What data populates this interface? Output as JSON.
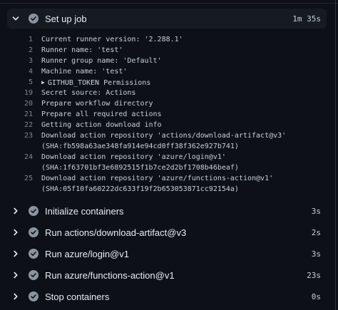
{
  "icons": {
    "chevron_down": "chevron-down-icon",
    "chevron_right": "chevron-right-icon",
    "check_circle": "check-circle-icon",
    "caret_right": "caret-right-icon"
  },
  "colors": {
    "background": "#0d1117",
    "step_expanded_bg": "#161b22",
    "check_circle": "#8b949e",
    "line_number": "#7d8590",
    "text": "#c9d1d9"
  },
  "header_step": {
    "label": "Set up job",
    "duration": "1m 35s"
  },
  "log": {
    "lines": [
      {
        "num": "1",
        "text": "Current runner version: '2.288.1'"
      },
      {
        "num": "2",
        "text": "Runner name: 'test'"
      },
      {
        "num": "3",
        "text": "Runner group name: 'Default'"
      },
      {
        "num": "4",
        "text": "Machine name: 'test'"
      },
      {
        "num": "5",
        "text": "GITHUB_TOKEN Permissions"
      },
      {
        "num": "19",
        "text": "Secret source: Actions"
      },
      {
        "num": "20",
        "text": "Prepare workflow directory"
      },
      {
        "num": "21",
        "text": "Prepare all required actions"
      },
      {
        "num": "22",
        "text": "Getting action download info"
      },
      {
        "num": "23",
        "text": "Download action repository 'actions/download-artifact@v3'"
      },
      {
        "num": "",
        "text": "(SHA:fb598a63ae348fa914e94cd0ff38f362e927b741)"
      },
      {
        "num": "24",
        "text": "Download action repository 'azure/login@v1'"
      },
      {
        "num": "",
        "text": "(SHA:1f63701bf3e6892515f1b7ce2d2bf1708b46beaf)"
      },
      {
        "num": "25",
        "text": "Download action repository 'azure/functions-action@v1'"
      },
      {
        "num": "",
        "text": "(SHA:05f10fa60222dc633f19f2b653053871cc92154a)"
      }
    ]
  },
  "steps": [
    {
      "label": "Initialize containers",
      "duration": "3s"
    },
    {
      "label": "Run actions/download-artifact@v3",
      "duration": "2s"
    },
    {
      "label": "Run azure/login@v1",
      "duration": "3s"
    },
    {
      "label": "Run azure/functions-action@v1",
      "duration": "23s"
    },
    {
      "label": "Stop containers",
      "duration": "0s"
    }
  ]
}
